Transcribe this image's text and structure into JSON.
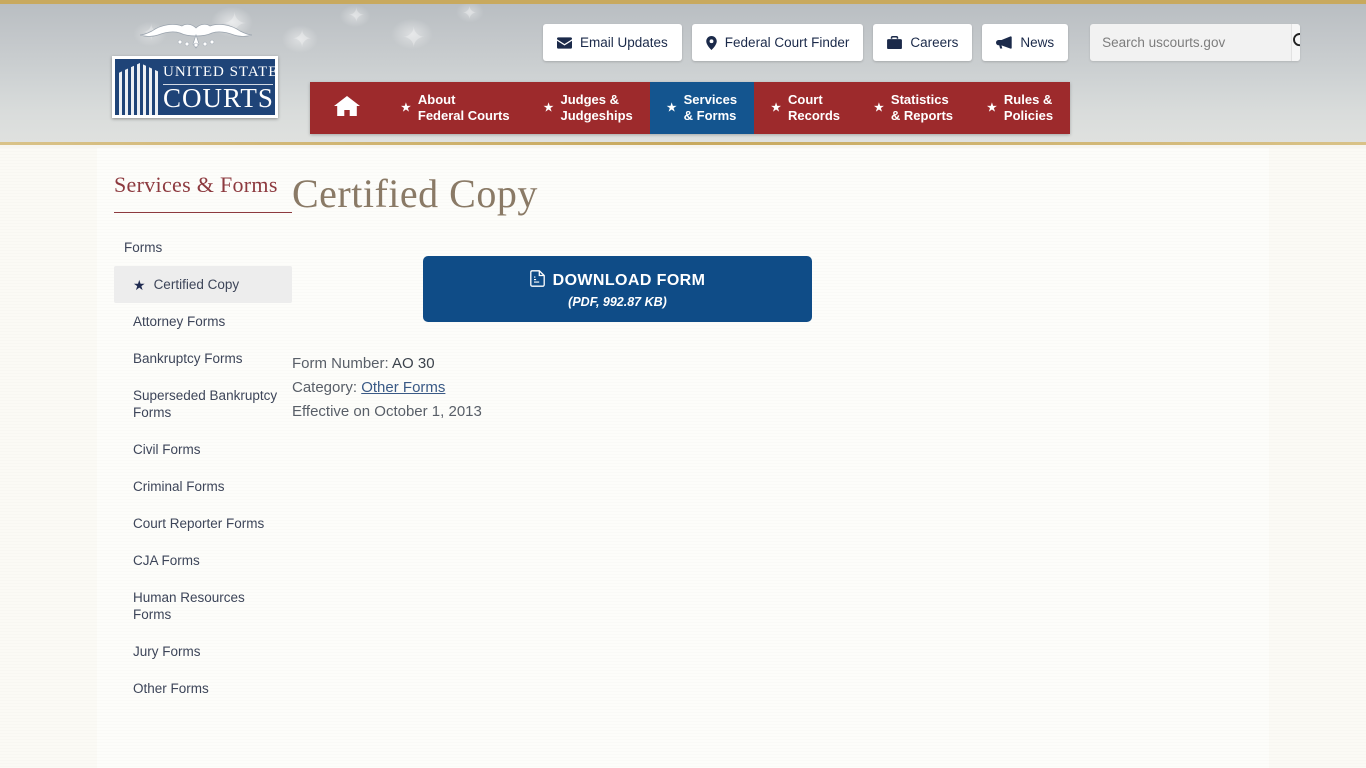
{
  "header": {
    "logo": {
      "line1": "UNITED STATES",
      "line2": "COURTS",
      "eagle_icon": "eagle-icon"
    },
    "utility_buttons": [
      {
        "label": "Email Updates",
        "icon": "envelope-icon"
      },
      {
        "label": "Federal Court Finder",
        "icon": "map-pin-icon"
      },
      {
        "label": "Careers",
        "icon": "briefcase-icon"
      },
      {
        "label": "News",
        "icon": "megaphone-icon"
      }
    ],
    "search": {
      "placeholder": "Search uscourts.gov",
      "value": "",
      "button_icon": "search-icon"
    },
    "nav": {
      "home_icon": "home-icon",
      "items": [
        {
          "line1": "About",
          "line2": "Federal Courts",
          "active": false
        },
        {
          "line1": "Judges &",
          "line2": "Judgeships",
          "active": false
        },
        {
          "line1": "Services",
          "line2": "& Forms",
          "active": true
        },
        {
          "line1": "Court",
          "line2": "Records",
          "active": false
        },
        {
          "line1": "Statistics",
          "line2": "& Reports",
          "active": false
        },
        {
          "line1": "Rules &",
          "line2": "Policies",
          "active": false
        }
      ]
    }
  },
  "sidebar": {
    "title": "Services & Forms",
    "items": [
      {
        "label": "Forms",
        "active": false,
        "root": true
      },
      {
        "label": "Certified Copy",
        "active": true,
        "root": false
      },
      {
        "label": "Attorney Forms",
        "active": false,
        "root": false
      },
      {
        "label": "Bankruptcy Forms",
        "active": false,
        "root": false
      },
      {
        "label": "Superseded Bankruptcy Forms",
        "active": false,
        "root": false
      },
      {
        "label": "Civil Forms",
        "active": false,
        "root": false
      },
      {
        "label": "Criminal Forms",
        "active": false,
        "root": false
      },
      {
        "label": "Court Reporter Forms",
        "active": false,
        "root": false
      },
      {
        "label": "CJA Forms",
        "active": false,
        "root": false
      },
      {
        "label": "Human Resources Forms",
        "active": false,
        "root": false
      },
      {
        "label": "Jury Forms",
        "active": false,
        "root": false
      },
      {
        "label": "Other Forms",
        "active": false,
        "root": false
      }
    ]
  },
  "main": {
    "title": "Certified Copy",
    "download": {
      "label": "DOWNLOAD FORM",
      "file_info": "(PDF, 992.87 KB)",
      "icon": "pdf-file-icon"
    },
    "meta": {
      "form_number_label": "Form Number:",
      "form_number_value": "AO 30",
      "category_label": "Category:",
      "category_value": "Other Forms",
      "effective_text": "Effective on October 1, 2013"
    }
  },
  "colors": {
    "nav_red": "#9d2a2c",
    "nav_active_blue": "#14558f",
    "button_blue": "#0f4c87",
    "gold_rule": "#c8a95e",
    "sidebar_heading": "#8d3a3f",
    "page_title": "#8a7a66"
  }
}
